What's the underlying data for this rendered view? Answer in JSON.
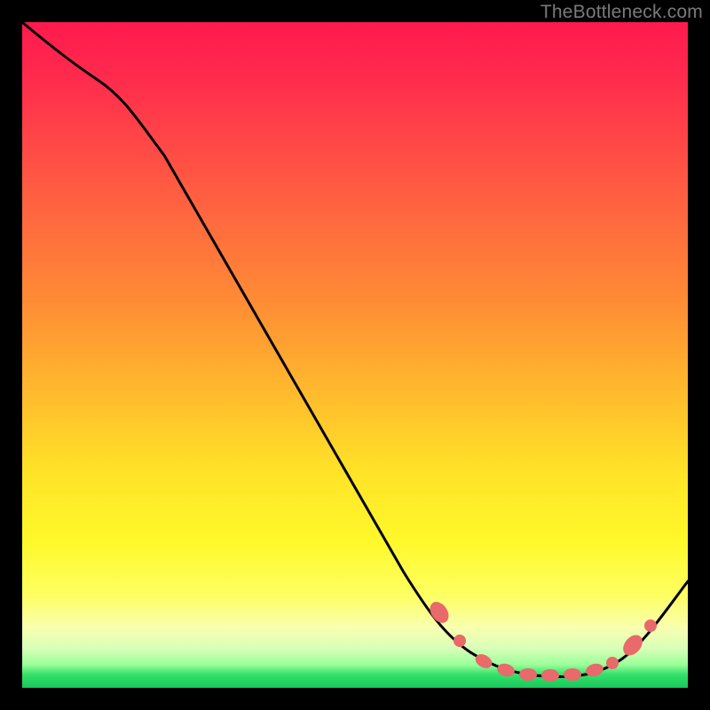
{
  "watermark": "TheBottleneck.com",
  "chart_data": {
    "type": "line",
    "title": "",
    "xlabel": "",
    "ylabel": "",
    "xlim": [
      0,
      100
    ],
    "ylim": [
      0,
      100
    ],
    "grid": false,
    "legend": false,
    "series": [
      {
        "name": "bottleneck-curve",
        "x": [
          0,
          6,
          12,
          18,
          24,
          30,
          36,
          42,
          48,
          54,
          60,
          64,
          68,
          72,
          76,
          80,
          84,
          88,
          92,
          96,
          100
        ],
        "y": [
          100,
          97,
          93,
          88,
          80,
          71,
          62,
          53,
          44,
          35,
          26,
          18,
          11,
          6,
          3,
          1.5,
          1,
          1.5,
          3.5,
          8,
          15
        ]
      }
    ],
    "markers": [
      {
        "x": 64,
        "y": 17,
        "shape": "ellipse",
        "size": "lg"
      },
      {
        "x": 67,
        "y": 12,
        "shape": "circle",
        "size": "sm"
      },
      {
        "x": 70,
        "y": 6,
        "shape": "ellipse",
        "size": "md"
      },
      {
        "x": 73,
        "y": 3.5,
        "shape": "ellipse",
        "size": "md"
      },
      {
        "x": 76,
        "y": 2.2,
        "shape": "ellipse",
        "size": "md"
      },
      {
        "x": 79,
        "y": 1.6,
        "shape": "ellipse",
        "size": "md"
      },
      {
        "x": 82,
        "y": 1.3,
        "shape": "ellipse",
        "size": "md"
      },
      {
        "x": 85,
        "y": 1.4,
        "shape": "ellipse",
        "size": "md"
      },
      {
        "x": 88,
        "y": 2.0,
        "shape": "circle",
        "size": "sm"
      },
      {
        "x": 90,
        "y": 4.5,
        "shape": "ellipse",
        "size": "lg"
      },
      {
        "x": 92,
        "y": 8.5,
        "shape": "circle",
        "size": "sm"
      }
    ],
    "background_gradient": {
      "top": "#ff1a4d",
      "mid": "#ffe428",
      "bottom": "#17c85c"
    }
  }
}
